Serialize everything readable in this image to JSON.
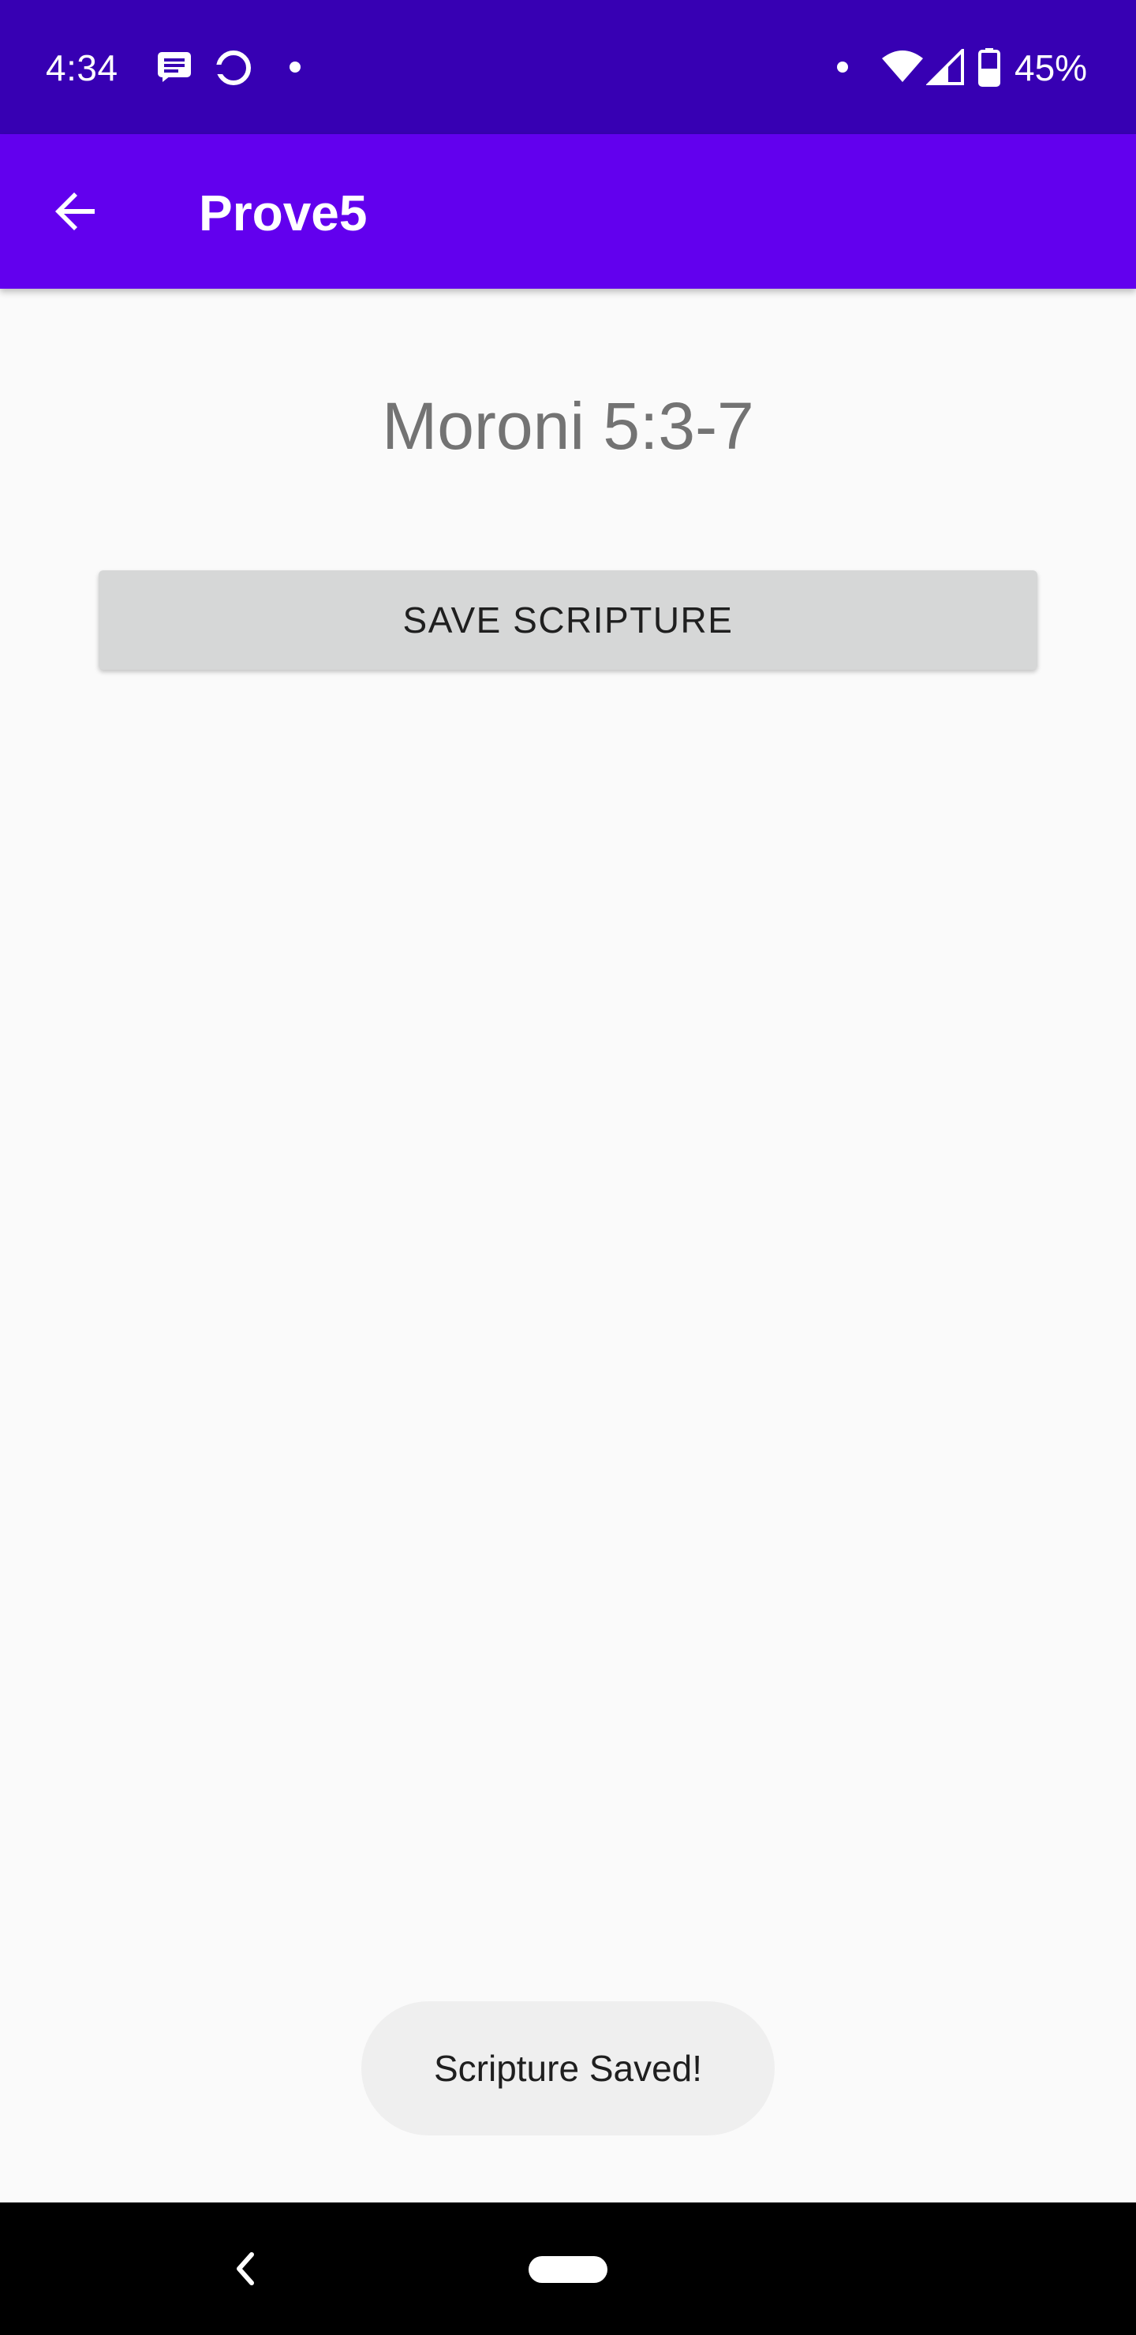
{
  "status_bar": {
    "time": "4:34",
    "battery_percent": "45%",
    "icons_left": [
      "message-notification-icon",
      "circle-app-icon",
      "dot-icon"
    ],
    "icons_right": [
      "dot-icon",
      "wifi-icon",
      "cell-signal-icon",
      "battery-icon"
    ],
    "background_color": "#3700b3"
  },
  "app_bar": {
    "title": "Prove5",
    "back_icon": "arrow-back-icon",
    "background_color": "#6200ee"
  },
  "main": {
    "scripture_reference": "Moroni 5:3-7",
    "save_button_label": "SAVE SCRIPTURE"
  },
  "toast": {
    "message": "Scripture Saved!"
  },
  "nav_bar": {
    "back_icon": "nav-back-icon",
    "home_icon": "home-pill-icon"
  }
}
